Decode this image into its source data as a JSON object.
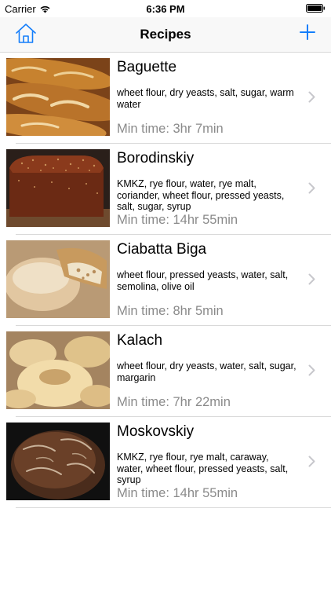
{
  "status_bar": {
    "carrier": "Carrier",
    "time": "6:36 PM"
  },
  "nav": {
    "title": "Recipes"
  },
  "colors": {
    "accent": "#147efb",
    "secondary_text": "#8a8a8a",
    "separator": "#d9d9d9"
  },
  "recipes": [
    {
      "name": "Baguette",
      "ingredients": "wheet flour, dry yeasts, salt, sugar, warm water",
      "min_time": "Min time: 3hr 7min"
    },
    {
      "name": "Borodinskiy",
      "ingredients": "KMKZ, rye flour, water, rye malt, coriander, wheet flour, pressed yeasts, salt, sugar, syrup",
      "min_time": "Min time: 14hr 55min"
    },
    {
      "name": "Ciabatta Biga",
      "ingredients": "wheet flour, pressed yeasts, water, salt, semolina, olive oil",
      "min_time": "Min time: 8hr 5min"
    },
    {
      "name": "Kalach",
      "ingredients": "wheet flour, dry yeasts, water, salt, sugar, margarin",
      "min_time": "Min time: 7hr 22min"
    },
    {
      "name": "Moskovskiy",
      "ingredients": "KMKZ, rye flour, rye malt, caraway, water, wheet flour, pressed yeasts, salt, syrup",
      "min_time": "Min time: 14hr 55min"
    }
  ]
}
